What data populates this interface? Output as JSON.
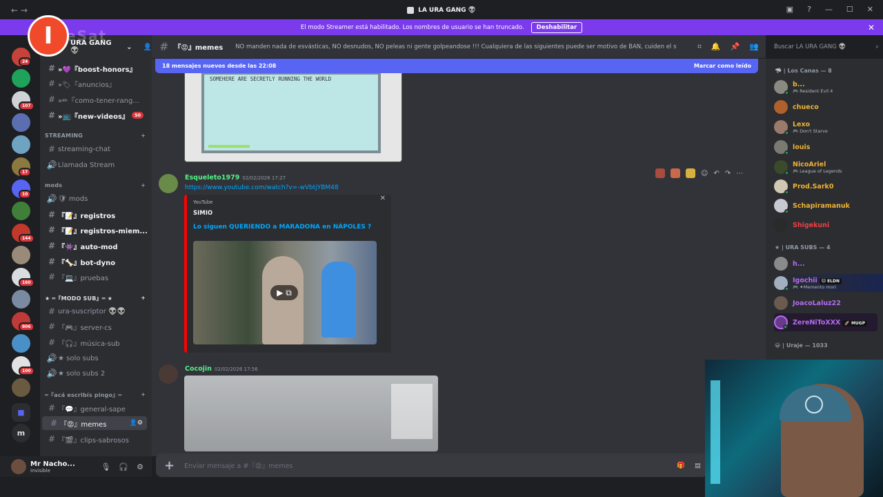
{
  "window": {
    "title": "LA URA GANG 👽"
  },
  "banner": {
    "text": "El modo Streamer está habilitado. Los nombres de usuario se han truncado.",
    "button": "Deshabilitar"
  },
  "server": {
    "name": "URA GANG 👽"
  },
  "sidebar": {
    "channels": [
      {
        "label": "»💜『boost-honors』",
        "unread": true
      },
      {
        "label": "»🏷『anuncios』",
        "unread": false
      },
      {
        "label": "»✏『como-tener-rang...",
        "unread": false
      },
      {
        "label": "»📺『new-videos』",
        "unread": true,
        "badge": "50"
      }
    ],
    "cat_streaming": "STREAMING",
    "streaming": [
      {
        "label": "streaming-chat",
        "icon": "#"
      },
      {
        "label": "Llamada Stream",
        "icon": "🔊"
      }
    ],
    "cat_mods": "mods",
    "mods": [
      {
        "label": "🛡 mods",
        "icon": "🔊",
        "unread": false
      },
      {
        "label": "『📝』registros",
        "unread": true
      },
      {
        "label": "『📝』registros-miem...",
        "unread": true
      },
      {
        "label": "『👾』auto-mod",
        "unread": true
      },
      {
        "label": "『🦴』bot-dyno",
        "unread": true
      },
      {
        "label": "『💻』pruebas",
        "unread": false
      }
    ],
    "cat_sub": "★ ═『MODO SUB』═ ★",
    "sub": [
      {
        "label": "ura-suscriptor 👽👽",
        "icon": "#"
      },
      {
        "label": "『🎮』server-cs",
        "icon": "#"
      },
      {
        "label": "『🎧』música-sub",
        "icon": "#"
      },
      {
        "label": "★ solo subs",
        "icon": "🔊"
      },
      {
        "label": "★ solo subs 2",
        "icon": "🔊"
      }
    ],
    "cat_pingo": "═『acá escribís pingo』═",
    "pingo": [
      {
        "label": "『💬』general-sape"
      },
      {
        "label": "『😡』memes",
        "active": true
      },
      {
        "label": "『🎬』clips-sabrosos"
      }
    ]
  },
  "rail": {
    "badges": [
      "24",
      "107",
      "17",
      "10",
      "144",
      "160",
      "806",
      "100"
    ],
    "letter": "m"
  },
  "user": {
    "name": "Mr Nacho...",
    "status": "Invisible"
  },
  "channel": {
    "name": "『😡』memes",
    "topic": "NO manden nada de esvásticas, NO desnudos, NO peleas ni gente golpeandose !!! Cualquiera de las siguientes puede ser motivo de BAN, cuiden el stream!"
  },
  "search": {
    "placeholder": "Buscar LA URA GANG 👽"
  },
  "newbar": {
    "text": "18 mensajes nuevos desde las 22:08",
    "mark": "Marcar como leído"
  },
  "image1": {
    "caption": "SOMEHERE ARE SECRETLY RUNNING THE WORLD"
  },
  "messages": [
    {
      "author": "Esqueleto1979",
      "time": "02/02/2026 17:27",
      "color": "#57f287",
      "link": "https://www.youtube.com/watch?v=-wVbtjYBM48",
      "embed": {
        "provider": "YouTube",
        "author": "SIMIO",
        "title": "Lo siguen QUERIENDO a MARADONA en NÁPOLES ?"
      }
    },
    {
      "author": "Cocojin",
      "time": "02/02/2026 17:56",
      "color": "#57f287"
    }
  ],
  "composer": {
    "placeholder": "Enviar mensaje a #『😡』memes"
  },
  "members": {
    "groups": [
      {
        "title": "🦈 | Los Canas — 8",
        "items": [
          {
            "name": "b...",
            "activity": "🎮 Resident Evil 4",
            "color": "#f0b232"
          },
          {
            "name": "chueco",
            "activity": "",
            "color": "#f0b232"
          },
          {
            "name": "Lexo",
            "activity": "🎮 Don't Starve",
            "color": "#f0b232"
          },
          {
            "name": "louis",
            "activity": "",
            "color": "#f0b232"
          },
          {
            "name": "NicoAriel",
            "activity": "🎮 League of Legends",
            "color": "#f0b232"
          },
          {
            "name": "Prod.Sark0",
            "activity": "",
            "color": "#f0b232"
          },
          {
            "name": "Schapiramanuk",
            "activity": "",
            "color": "#f0b232"
          },
          {
            "name": "Shigekuni",
            "activity": "",
            "color": "#f23f43"
          }
        ]
      },
      {
        "title": "★ | URA SUBS — 4",
        "items": [
          {
            "name": "h...",
            "activity": "",
            "color": "#b56cf0"
          },
          {
            "name": "Igochii",
            "tag": "🐱 ELDN",
            "activity": "🎮 ✦Memento mori",
            "color": "#b56cf0"
          },
          {
            "name": "JoacoLaluz22",
            "activity": "",
            "color": "#b56cf0"
          },
          {
            "name": "ZereNiToXXX",
            "tag": "🚀 MUGP",
            "activity": "",
            "color": "#b56cf0"
          }
        ]
      },
      {
        "title": "😀 | Uraje — 1033",
        "items": []
      }
    ]
  },
  "colors": {
    "accent": "#7c3aed",
    "blurple": "#5865f2",
    "link": "#00a8fc",
    "bg": "#313338"
  }
}
